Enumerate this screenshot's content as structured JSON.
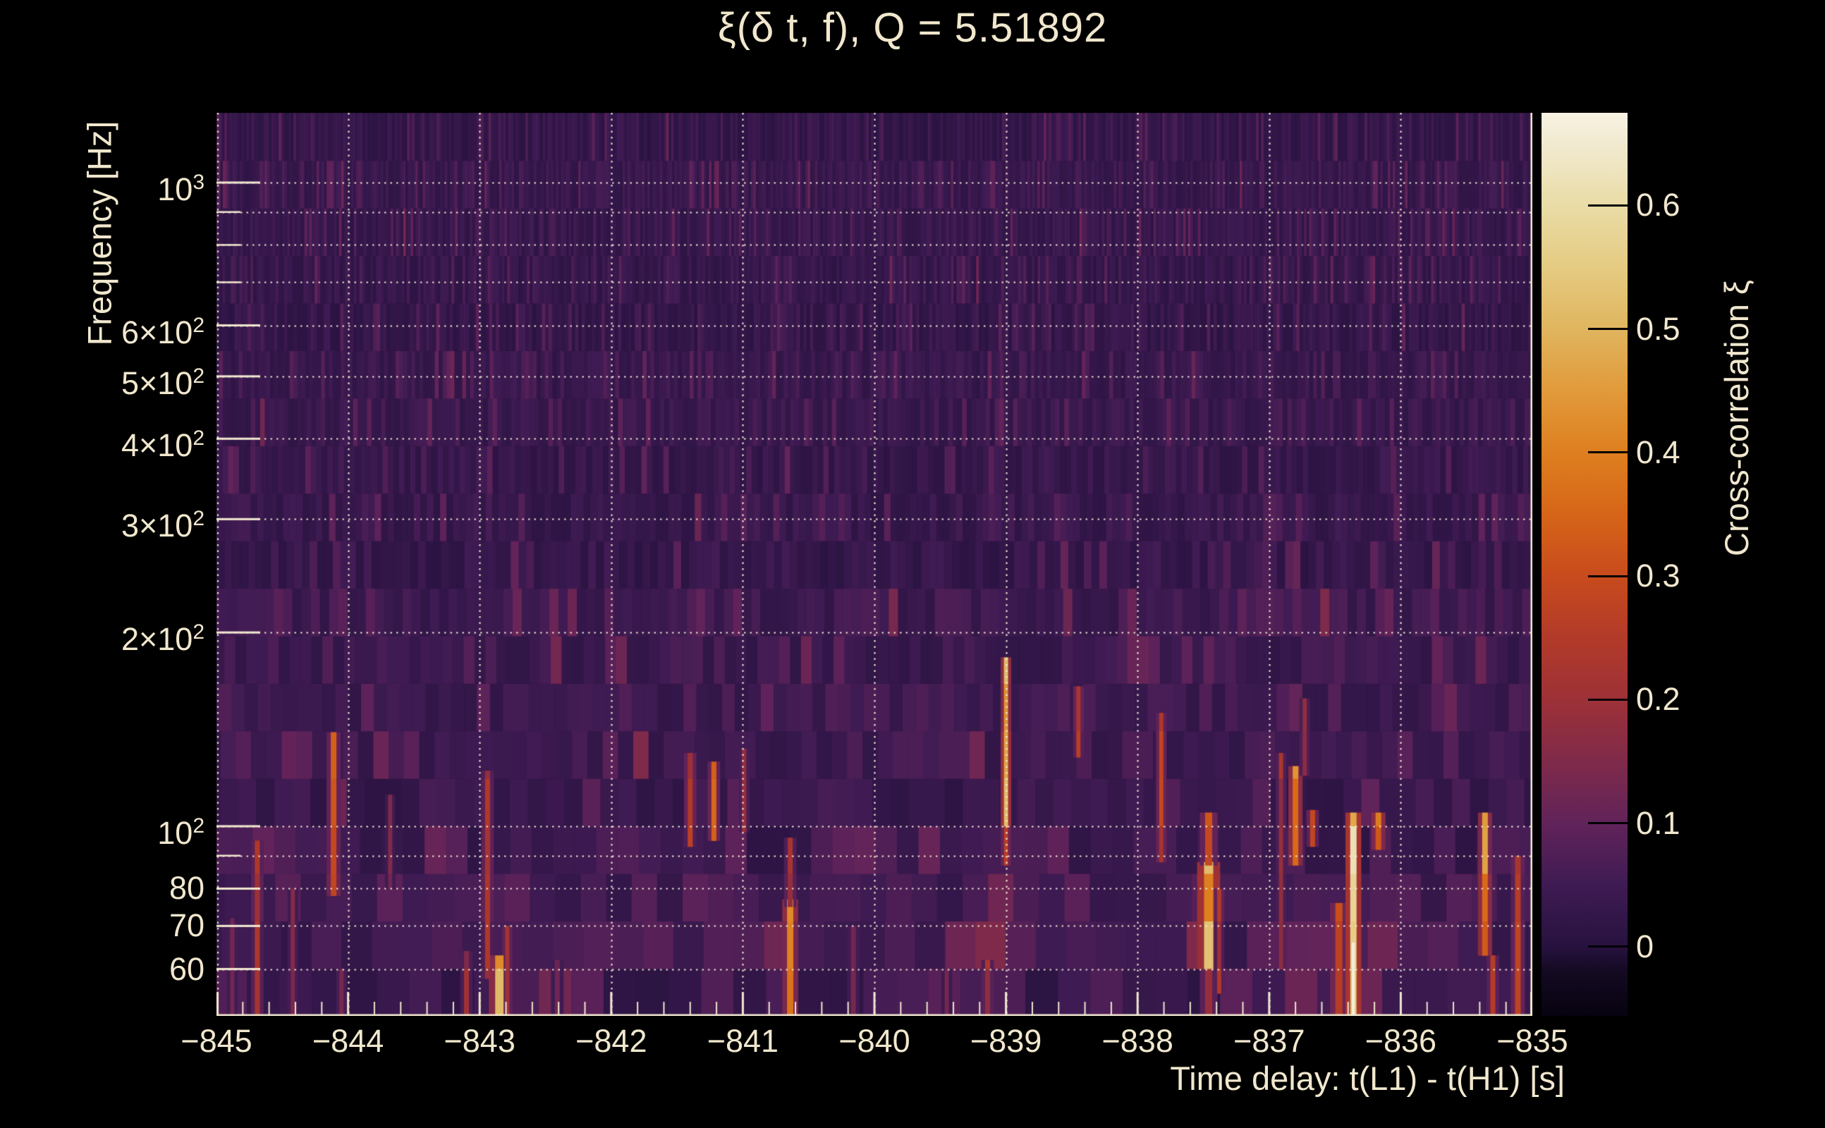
{
  "title": {
    "text": "ξ(δ t, f), Q = 5.51892"
  },
  "axes": {
    "x": {
      "title": "Time delay: t(L1) - t(H1) [s]",
      "min": -845,
      "max": -835,
      "minor_tick_step": 0.2,
      "ticks": [
        {
          "label": "−845",
          "value": -845
        },
        {
          "label": "−844",
          "value": -844
        },
        {
          "label": "−843",
          "value": -843
        },
        {
          "label": "−842",
          "value": -842
        },
        {
          "label": "−841",
          "value": -841
        },
        {
          "label": "−840",
          "value": -840
        },
        {
          "label": "−839",
          "value": -839
        },
        {
          "label": "−838",
          "value": -838
        },
        {
          "label": "−837",
          "value": -837
        },
        {
          "label": "−836",
          "value": -836
        },
        {
          "label": "−835",
          "value": -835
        }
      ]
    },
    "y": {
      "title": "Frequency [Hz]",
      "scale": "log",
      "min": 50.7,
      "max": 1283,
      "ticks": [
        {
          "prefix": "10",
          "exp": "3",
          "value": 1000
        },
        {
          "prefix": "6×10",
          "exp": "2",
          "value": 600
        },
        {
          "prefix": "5×10",
          "exp": "2",
          "value": 500
        },
        {
          "prefix": "4×10",
          "exp": "2",
          "value": 400
        },
        {
          "prefix": "3×10",
          "exp": "2",
          "value": 300
        },
        {
          "prefix": "2×10",
          "exp": "2",
          "value": 200
        },
        {
          "prefix": "10",
          "exp": "2",
          "value": 100
        },
        {
          "prefix": "80",
          "exp": "",
          "value": 80
        },
        {
          "prefix": "70",
          "exp": "",
          "value": 70
        },
        {
          "prefix": "60",
          "exp": "",
          "value": 60
        }
      ],
      "grid_values": [
        60,
        70,
        80,
        90,
        100,
        200,
        300,
        400,
        500,
        600,
        700,
        800,
        900,
        1000
      ],
      "major_values": [
        1000,
        600,
        500,
        400,
        300,
        200,
        100,
        80,
        70,
        60
      ],
      "minor_values": [
        900,
        800,
        700,
        90
      ]
    },
    "z": {
      "title": "Cross-correlation ξ",
      "min": -0.056,
      "max": 0.675,
      "ticks": [
        {
          "label": "0.6",
          "value": 0.6
        },
        {
          "label": "0.5",
          "value": 0.5
        },
        {
          "label": "0.4",
          "value": 0.4
        },
        {
          "label": "0.3",
          "value": 0.3
        },
        {
          "label": "0.2",
          "value": 0.2
        },
        {
          "label": "0.1",
          "value": 0.1
        },
        {
          "label": "0",
          "value": 0
        }
      ]
    }
  },
  "chart_data": {
    "type": "heatmap",
    "title": "ξ(δ t, f), Q = 5.51892",
    "q_value": 5.51892,
    "xlabel": "Time delay: t(L1) - t(H1) [s]",
    "ylabel": "Frequency [Hz]",
    "zlabel": "Cross-correlation ξ",
    "x_range_s": [
      -845,
      -835
    ],
    "y_range_hz": [
      50.7,
      1283
    ],
    "y_scale": "log",
    "z_range": [
      -0.056,
      0.675
    ],
    "background": {
      "typical_xi": 0.03,
      "noise_max_xi": 0.12,
      "tiling": "constant-Q log-frequency rows, cell width shrinks with frequency"
    },
    "features": [
      {
        "t": -844.88,
        "f_low": 51,
        "f_high": 72,
        "xi_peak": 0.13,
        "width_s": 0.032
      },
      {
        "t": -844.69,
        "f_low": 51,
        "f_high": 95,
        "xi_peak": 0.22,
        "width_s": 0.038
      },
      {
        "t": -844.42,
        "f_low": 51,
        "f_high": 80,
        "xi_peak": 0.15,
        "width_s": 0.032
      },
      {
        "t": -844.11,
        "f_low": 78,
        "f_high": 140,
        "xi_peak": 0.3,
        "width_s": 0.043
      },
      {
        "t": -844.05,
        "f_low": 51,
        "f_high": 60,
        "xi_peak": 0.15,
        "width_s": 0.032
      },
      {
        "t": -843.68,
        "f_low": 80,
        "f_high": 112,
        "xi_peak": 0.13,
        "width_s": 0.032
      },
      {
        "t": -843.1,
        "f_low": 51,
        "f_high": 64,
        "xi_peak": 0.18,
        "width_s": 0.038
      },
      {
        "t": -842.94,
        "f_low": 58,
        "f_high": 122,
        "xi_peak": 0.22,
        "width_s": 0.038
      },
      {
        "t": -842.85,
        "f_low": 51,
        "f_high": 63,
        "xi_peak": 0.46,
        "width_s": 0.064
      },
      {
        "t": -842.79,
        "f_low": 51,
        "f_high": 70,
        "xi_peak": 0.22,
        "width_s": 0.032
      },
      {
        "t": -842.41,
        "f_low": 51,
        "f_high": 62,
        "xi_peak": 0.13,
        "width_s": 0.038
      },
      {
        "t": -841.4,
        "f_low": 93,
        "f_high": 130,
        "xi_peak": 0.24,
        "width_s": 0.038
      },
      {
        "t": -841.22,
        "f_low": 95,
        "f_high": 126,
        "xi_peak": 0.3,
        "width_s": 0.038
      },
      {
        "t": -840.99,
        "f_low": 98,
        "f_high": 132,
        "xi_peak": 0.18,
        "width_s": 0.032
      },
      {
        "t": -840.64,
        "f_low": 51,
        "f_high": 77,
        "xi_peak": 0.42,
        "width_s": 0.048
      },
      {
        "t": -840.64,
        "f_low": 75,
        "f_high": 96,
        "xi_peak": 0.2,
        "width_s": 0.038
      },
      {
        "t": -840.16,
        "f_low": 51,
        "f_high": 70,
        "xi_peak": 0.13,
        "width_s": 0.038
      },
      {
        "t": -839.45,
        "f_low": 51,
        "f_high": 60,
        "xi_peak": 0.12,
        "width_s": 0.032
      },
      {
        "t": -839.14,
        "f_low": 51,
        "f_high": 62,
        "xi_peak": 0.2,
        "width_s": 0.038
      },
      {
        "t": -839.0,
        "f_low": 100,
        "f_high": 183,
        "xi_peak": 0.46,
        "width_s": 0.032
      },
      {
        "t": -839.0,
        "f_low": 87,
        "f_high": 100,
        "xi_peak": 0.3,
        "width_s": 0.032
      },
      {
        "t": -838.45,
        "f_low": 128,
        "f_high": 165,
        "xi_peak": 0.25,
        "width_s": 0.032
      },
      {
        "t": -837.82,
        "f_low": 88,
        "f_high": 150,
        "xi_peak": 0.25,
        "width_s": 0.032
      },
      {
        "t": -837.46,
        "f_low": 60,
        "f_high": 88,
        "xi_peak": 0.47,
        "width_s": 0.07
      },
      {
        "t": -837.46,
        "f_low": 87,
        "f_high": 105,
        "xi_peak": 0.3,
        "width_s": 0.054
      },
      {
        "t": -837.46,
        "f_low": 51,
        "f_high": 60,
        "xi_peak": 0.22,
        "width_s": 0.054
      },
      {
        "t": -837.38,
        "f_low": 55,
        "f_high": 80,
        "xi_peak": 0.22,
        "width_s": 0.032
      },
      {
        "t": -836.91,
        "f_low": 60,
        "f_high": 130,
        "xi_peak": 0.2,
        "width_s": 0.032
      },
      {
        "t": -836.8,
        "f_low": 87,
        "f_high": 124,
        "xi_peak": 0.4,
        "width_s": 0.043
      },
      {
        "t": -836.73,
        "f_low": 120,
        "f_high": 158,
        "xi_peak": 0.18,
        "width_s": 0.032
      },
      {
        "t": -836.67,
        "f_low": 93,
        "f_high": 106,
        "xi_peak": 0.25,
        "width_s": 0.038
      },
      {
        "t": -836.47,
        "f_low": 51,
        "f_high": 76,
        "xi_peak": 0.28,
        "width_s": 0.054
      },
      {
        "t": -836.36,
        "f_low": 51,
        "f_high": 105,
        "xi_peak": 0.55,
        "width_s": 0.048,
        "core_xi": 0.66,
        "core_f_high": 66
      },
      {
        "t": -836.17,
        "f_low": 92,
        "f_high": 105,
        "xi_peak": 0.38,
        "width_s": 0.043
      },
      {
        "t": -835.36,
        "f_low": 63,
        "f_high": 105,
        "xi_peak": 0.4,
        "width_s": 0.043
      },
      {
        "t": -835.3,
        "f_low": 51,
        "f_high": 63,
        "xi_peak": 0.22,
        "width_s": 0.038
      },
      {
        "t": -835.11,
        "f_low": 51,
        "f_high": 90,
        "xi_peak": 0.26,
        "width_s": 0.043
      }
    ]
  },
  "colors": {
    "background": "#000000",
    "text": "#f0e7cd",
    "grid": "#f1e8d0",
    "colormap_stops": [
      {
        "v": -0.056,
        "color": "#070310"
      },
      {
        "v": -0.02,
        "color": "#140a22"
      },
      {
        "v": 0.0,
        "color": "#27123f"
      },
      {
        "v": 0.05,
        "color": "#3f1b53"
      },
      {
        "v": 0.1,
        "color": "#61235a"
      },
      {
        "v": 0.15,
        "color": "#7f2a4a"
      },
      {
        "v": 0.2,
        "color": "#9d3137"
      },
      {
        "v": 0.25,
        "color": "#b23a29"
      },
      {
        "v": 0.3,
        "color": "#c84b1d"
      },
      {
        "v": 0.35,
        "color": "#d66518"
      },
      {
        "v": 0.4,
        "color": "#de7f20"
      },
      {
        "v": 0.45,
        "color": "#e19a3b"
      },
      {
        "v": 0.5,
        "color": "#e0b55e"
      },
      {
        "v": 0.55,
        "color": "#e5cb82"
      },
      {
        "v": 0.6,
        "color": "#e9dca6"
      },
      {
        "v": 0.65,
        "color": "#f2ead0"
      },
      {
        "v": 0.675,
        "color": "#f7f2e2"
      }
    ]
  }
}
